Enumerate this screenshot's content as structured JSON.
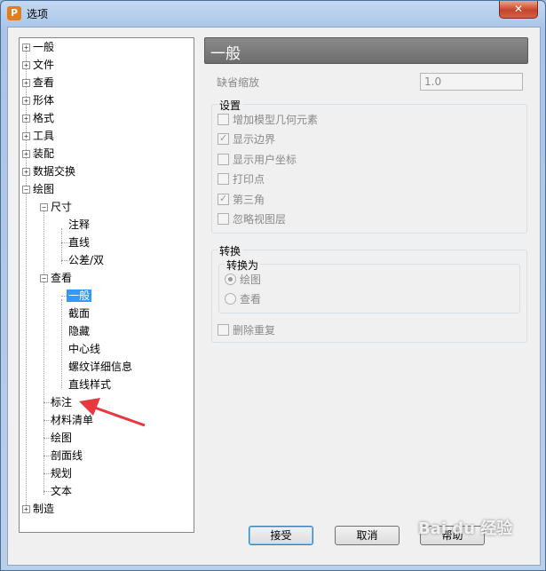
{
  "window": {
    "title": "选项",
    "close_glyph": "✕",
    "app_icon_letter": "P"
  },
  "tree": {
    "items": [
      {
        "label": "一般"
      },
      {
        "label": "文件"
      },
      {
        "label": "查看"
      },
      {
        "label": "形体"
      },
      {
        "label": "格式"
      },
      {
        "label": "工具"
      },
      {
        "label": "装配"
      },
      {
        "label": "数据交换"
      },
      {
        "label": "绘图"
      },
      {
        "label": "尺寸"
      },
      {
        "label": "注释"
      },
      {
        "label": "直线"
      },
      {
        "label": "公差/双"
      },
      {
        "label": "查看"
      },
      {
        "label": "一般"
      },
      {
        "label": "截面"
      },
      {
        "label": "隐藏"
      },
      {
        "label": "中心线"
      },
      {
        "label": "螺纹详细信息"
      },
      {
        "label": "直线样式"
      },
      {
        "label": "标注"
      },
      {
        "label": "材料清单"
      },
      {
        "label": "绘图"
      },
      {
        "label": "剖面线"
      },
      {
        "label": "规划"
      },
      {
        "label": "文本"
      },
      {
        "label": "制造"
      }
    ],
    "expand_plus": "+",
    "expand_minus": "−"
  },
  "panel": {
    "header": "一般",
    "default_scale_label": "缺省缩放",
    "default_scale_value": "1.0",
    "settings": {
      "title": "设置",
      "options": [
        {
          "label": "增加模型几何元素",
          "checked": false
        },
        {
          "label": "显示边界",
          "checked": true
        },
        {
          "label": "显示用户坐标",
          "checked": false
        },
        {
          "label": "打印点",
          "checked": false
        },
        {
          "label": "第三角",
          "checked": true
        },
        {
          "label": "忽略视图层",
          "checked": false
        }
      ]
    },
    "convert": {
      "title": "转换",
      "convert_to_title": "转换为",
      "radios": [
        {
          "label": "绘图",
          "selected": true
        },
        {
          "label": "查看",
          "selected": false
        }
      ],
      "remove_duplicates_label": "删除重复"
    }
  },
  "buttons": {
    "accept": "接受",
    "cancel": "取消",
    "help": "帮助"
  },
  "check_glyph": "✓",
  "watermark": "Bai du 经验",
  "colors": {
    "annotation_arrow": "#e8383d",
    "selection": "#3399ff",
    "header_bar": "#7a7a7a"
  }
}
